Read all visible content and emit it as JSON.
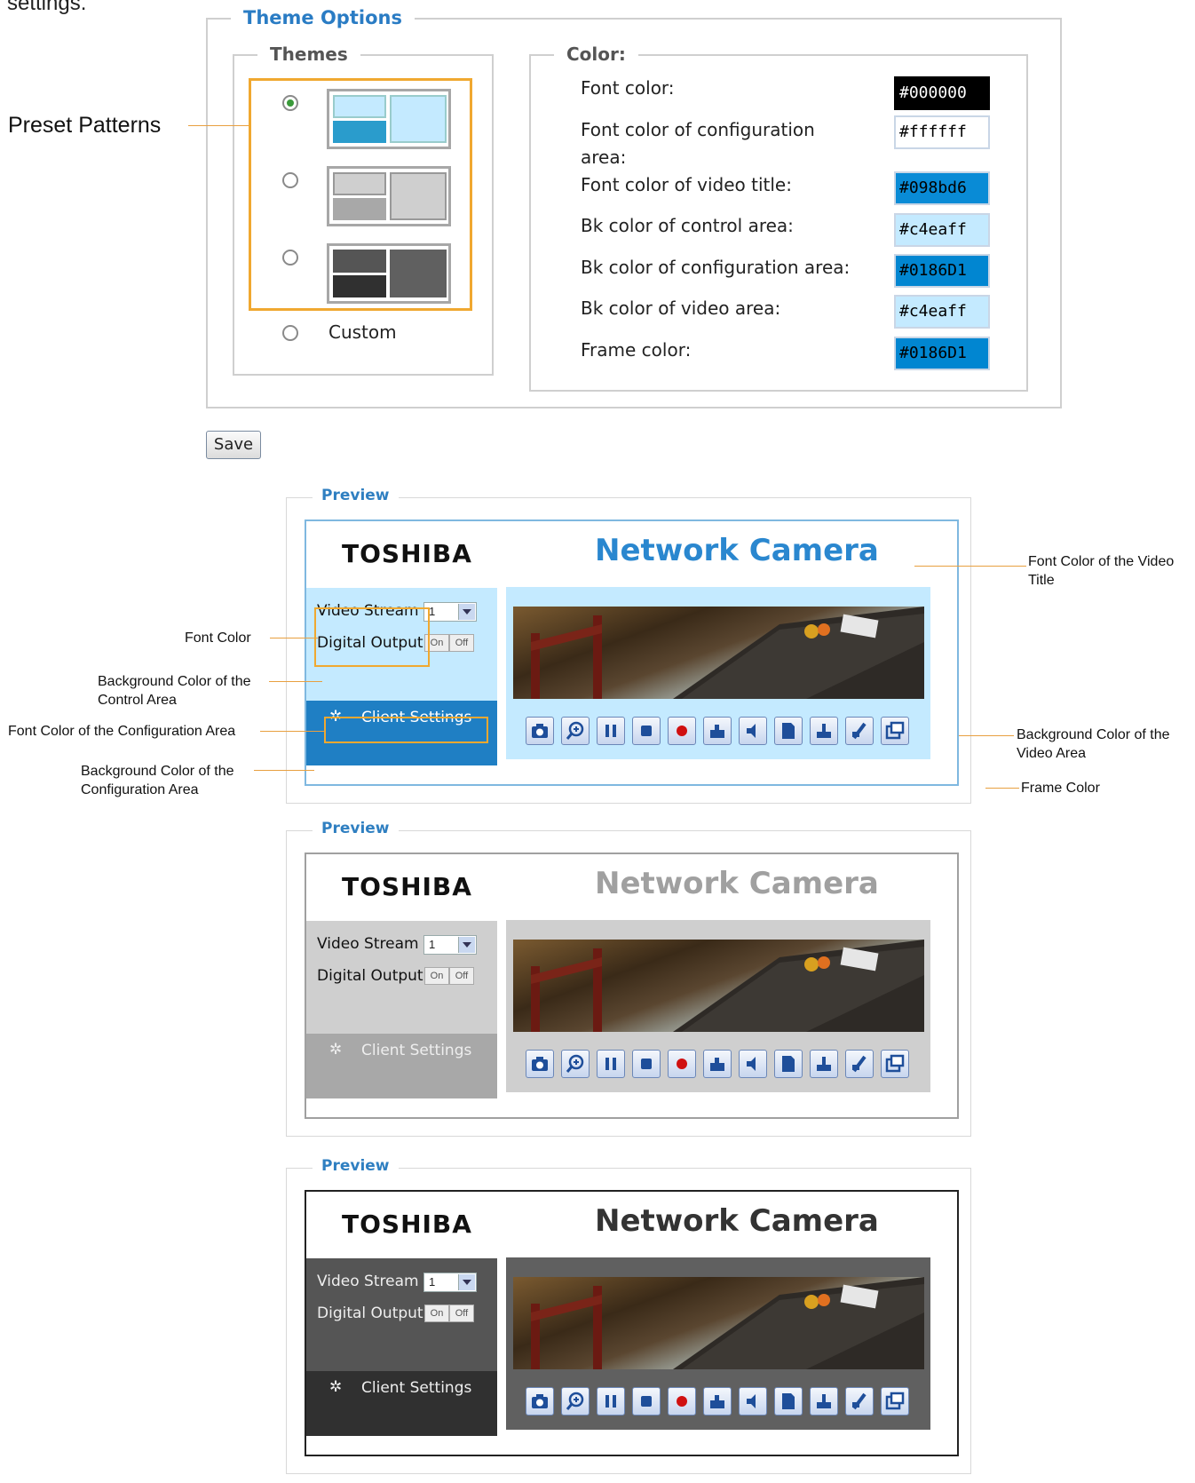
{
  "intro_fragment": "settings.",
  "theme_options": {
    "legend": "Theme Options",
    "themes": {
      "legend": "Themes",
      "custom_label": "Custom",
      "selected_index": 0
    },
    "color": {
      "legend": "Color:",
      "fields": [
        {
          "label": "Font color:",
          "value": "#000000",
          "bg": "#000000",
          "fg": "#ffffff"
        },
        {
          "label": "Font color of configuration area:",
          "value": "#ffffff",
          "bg": "#ffffff",
          "fg": "#000000"
        },
        {
          "label": "Font color of video title:",
          "value": "#098bd6",
          "bg": "#098bd6",
          "fg": "#000000"
        },
        {
          "label": "Bk color of control area:",
          "value": "#c4eaff",
          "bg": "#c4eaff",
          "fg": "#000000"
        },
        {
          "label": "Bk color of configuration area:",
          "value": "#0186D1",
          "bg": "#0186D1",
          "fg": "#000000"
        },
        {
          "label": "Bk color of video area:",
          "value": "#c4eaff",
          "bg": "#c4eaff",
          "fg": "#000000"
        },
        {
          "label": "Frame color:",
          "value": "#0186D1",
          "bg": "#0186D1",
          "fg": "#000000"
        }
      ]
    }
  },
  "save_label": "Save",
  "annotations": {
    "preset_patterns": "Preset Patterns",
    "font_color_video_title": "Font Color of the Video Title",
    "font_color": "Font Color",
    "bg_control_area": "Background Color of the Control Area",
    "font_color_config": "Font Color of the Configuration Area",
    "bg_config_area": "Background Color of the Configuration Area",
    "bg_video_area": "Background Color of the Video Area",
    "frame_color": "Frame Color"
  },
  "preview": {
    "legend": "Preview",
    "logo": "TOSHIBA",
    "title": "Network Camera",
    "video_stream_label": "Video Stream",
    "video_stream_value": "1",
    "digital_output_label": "Digital Output",
    "on_label": "On",
    "off_label": "Off",
    "client_settings": "Client Settings"
  },
  "preview_themes": [
    {
      "title_color": "#2a87cf",
      "font_color": "#111111",
      "ctrl_bg": "#c4eaff",
      "cfg_bg": "#1f7fc4",
      "cfg_font": "#ffffff",
      "vid_bg": "#c4eaff",
      "frame": "#7fb8e0"
    },
    {
      "title_color": "#a0a0a0",
      "font_color": "#111111",
      "ctrl_bg": "#cfcfcf",
      "cfg_bg": "#a8a8a8",
      "cfg_font": "#eeeeee",
      "vid_bg": "#cfcfcf",
      "frame": "#a0a0a0"
    },
    {
      "title_color": "#333333",
      "font_color": "#eeeeee",
      "ctrl_bg": "#555555",
      "cfg_bg": "#303030",
      "cfg_font": "#eeeeee",
      "vid_bg": "#606060",
      "frame": "#222222"
    }
  ]
}
